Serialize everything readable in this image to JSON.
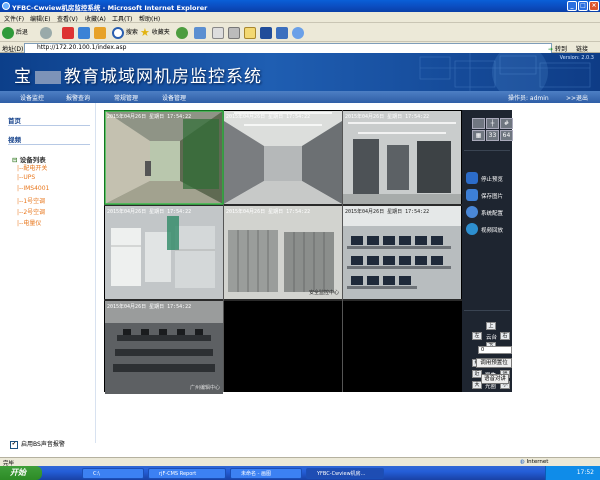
{
  "window": {
    "title": "YFBC-Cwview机房监控系统 - Microsoft Internet Explorer"
  },
  "menubar": [
    "文件(F)",
    "编辑(E)",
    "查看(V)",
    "收藏(A)",
    "工具(T)",
    "帮助(H)"
  ],
  "toolbar": {
    "back": "后退",
    "search": "搜索",
    "favorites": "收藏夹"
  },
  "address": {
    "label": "地址(D)",
    "url": "http://172.20.100.1/index.asp",
    "go": "转到",
    "links": "链接"
  },
  "banner": {
    "title_left": "宝",
    "title_right": "教育城域网机房监控系统",
    "version": "Version: 2.0.3"
  },
  "nav": {
    "items": [
      "设备监控",
      "报警查询",
      "常规管理",
      "设备管理"
    ],
    "operator": "操作员: admin",
    "logout": ">>退出"
  },
  "sidebar": {
    "home": "首页",
    "video": "视频",
    "tree_root": "设备列表",
    "devices": [
      "|--配电开关",
      "|--UPS",
      "|--IMS4001",
      "|--1号空调",
      "|--2号空调",
      "|--电量仪"
    ]
  },
  "video": {
    "timestamps": [
      "2015年04月26日 星期日 17:54:22",
      "2015年04月26日 星期日 17:54:22",
      "2015年04月26日 星期日 17:54:22",
      "2015年04月26日 星期日 17:54:22",
      "2015年04月26日 星期日 17:54:22",
      "2015年04月26日 星期日 17:54:22",
      "2015年04月26日 星期日 17:54:22"
    ],
    "captions": [
      "",
      "",
      "",
      "",
      "",
      "",
      "广州编辑中心"
    ],
    "cap5": "安全监控中心"
  },
  "controls": {
    "layouts": [
      "1",
      "4",
      "9",
      "33",
      "64"
    ],
    "menu": [
      "停止预览",
      "保存图片",
      "系统配置",
      "视频回放"
    ],
    "ptz": {
      "up": "上",
      "left": "左",
      "center": "云台",
      "right": "右",
      "down": "下"
    },
    "lens": [
      {
        "minus": "缩",
        "label": "调焦",
        "plus": "伸"
      },
      {
        "minus": "近",
        "label": "聚焦",
        "plus": "远"
      },
      {
        "minus": "大",
        "label": "光圈",
        "plus": "小"
      }
    ],
    "preset_value": "0",
    "preset_button": "调用预置位",
    "talk_button": "语音对讲"
  },
  "footer": {
    "alarm_label": "启用BS声音报警",
    "alarm_checked": "✔"
  },
  "statusbar": {
    "text": "完毕",
    "zone": "Internet"
  },
  "taskbar": {
    "start": "开始",
    "tasks": [
      "C:\\",
      "rjF-CMS Report",
      "未命名 - 画图",
      "YFBC-Cwview机房..."
    ],
    "clock": "17:52"
  }
}
